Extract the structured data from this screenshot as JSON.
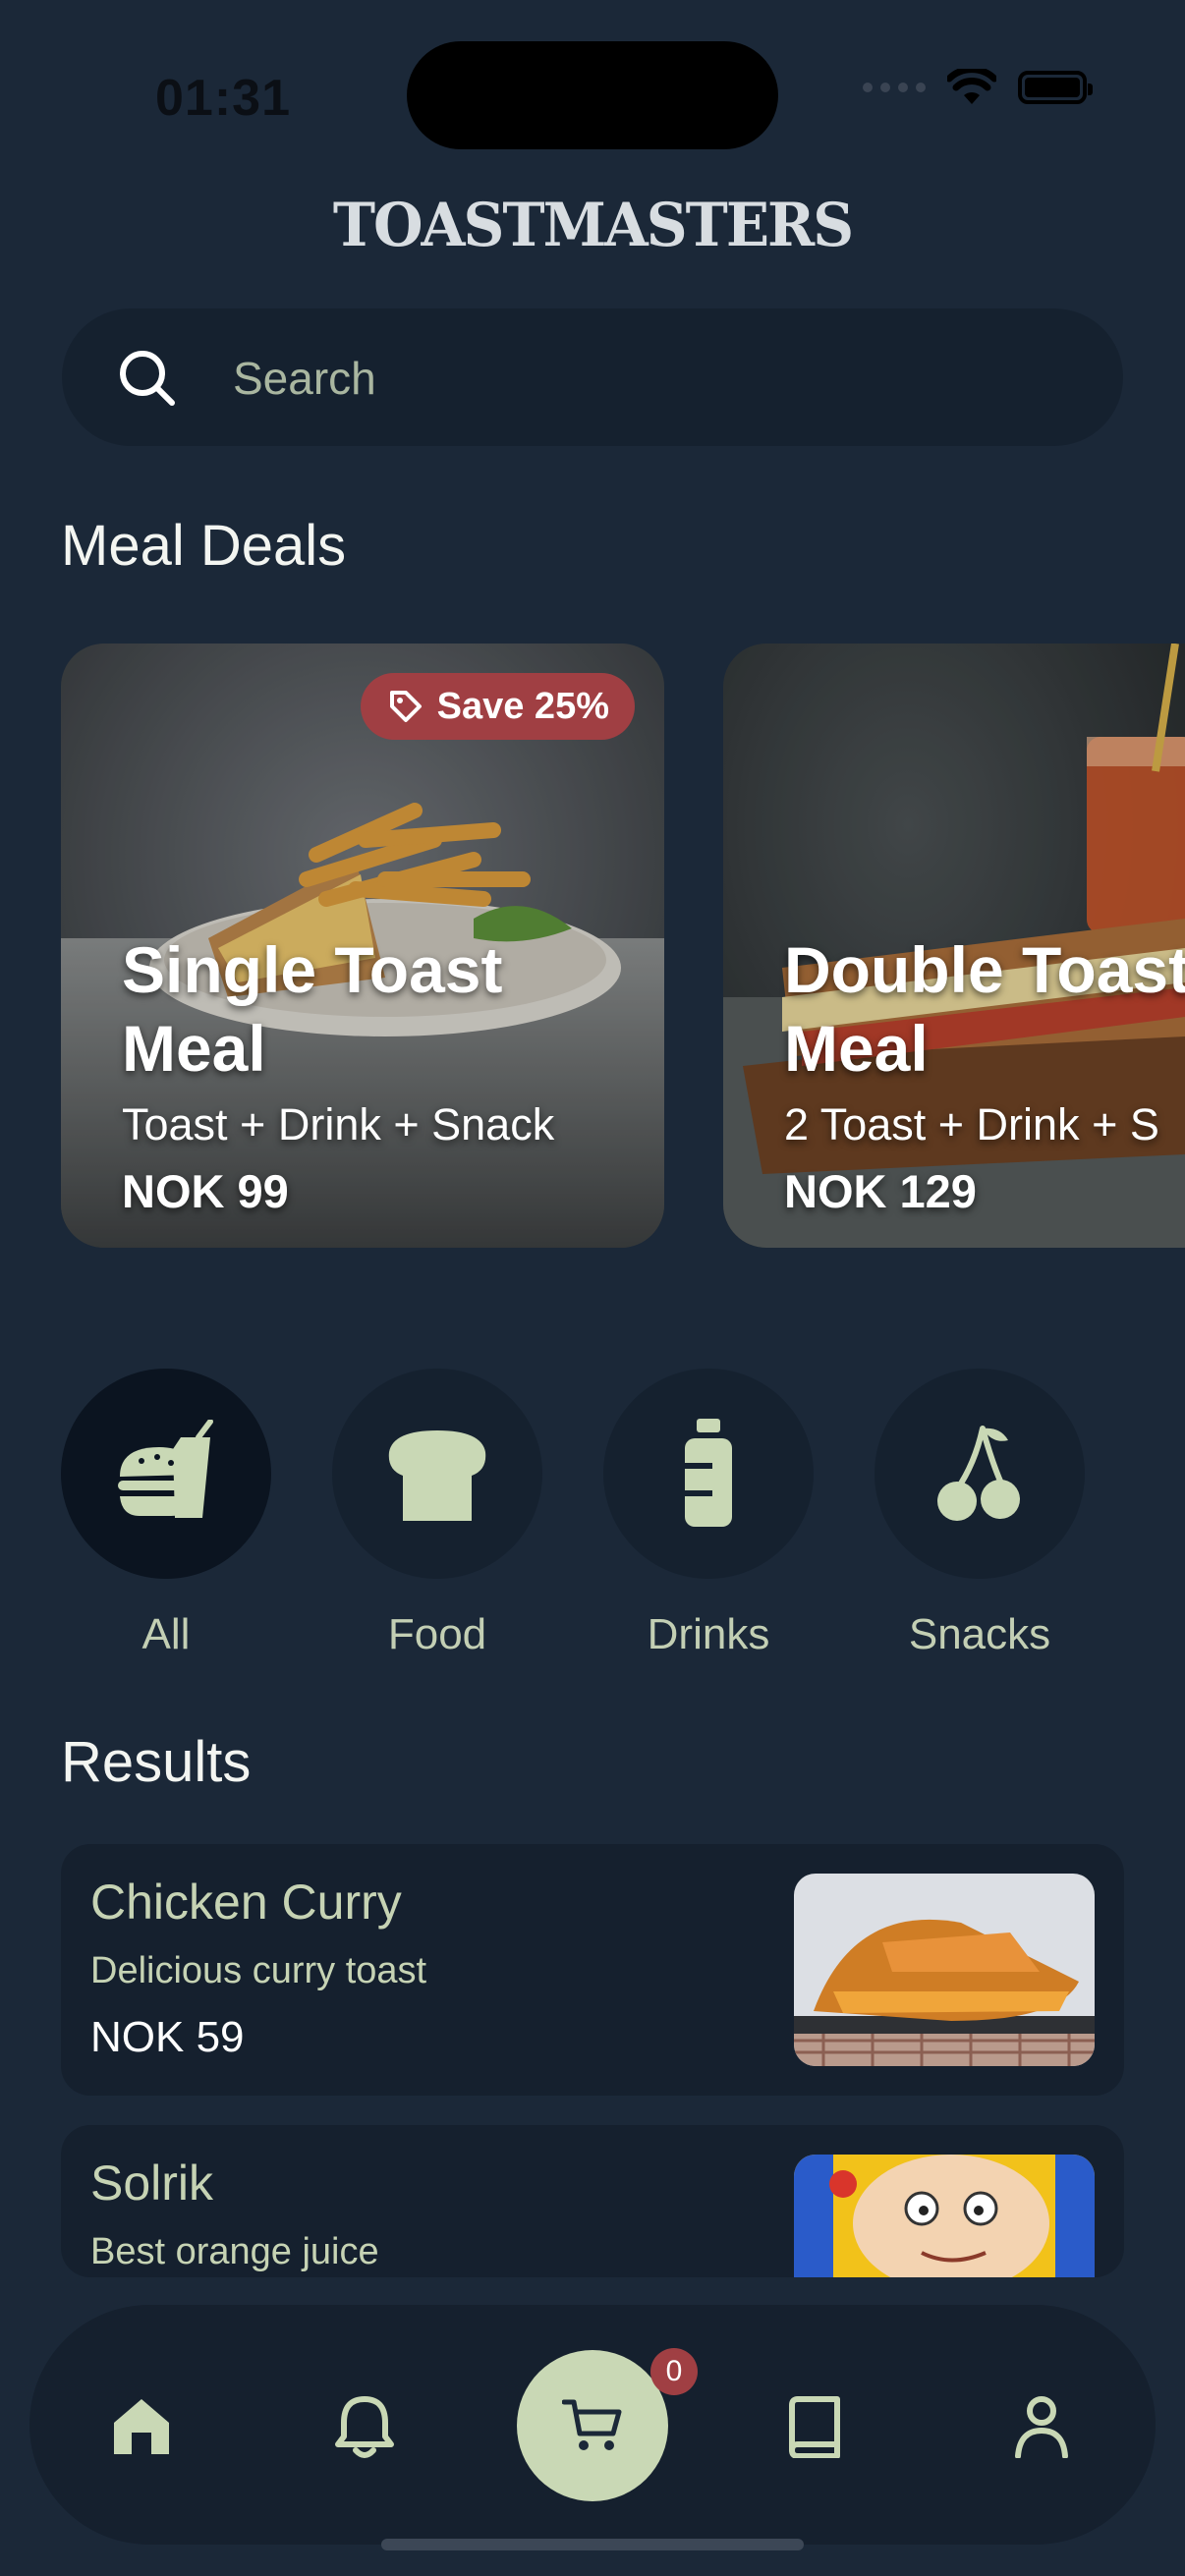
{
  "status_bar": {
    "time": "01:31"
  },
  "brand": "TOASTMASTERS",
  "search": {
    "placeholder": "Search"
  },
  "deals_section": {
    "title": "Meal Deals"
  },
  "deals": [
    {
      "title_line1": "Single Toast",
      "title_line2": "Meal",
      "subtitle": "Toast + Drink + Snack",
      "price": "NOK 99",
      "badge": "Save 25%"
    },
    {
      "title_line1": "Double Toast",
      "title_line2": "Meal",
      "subtitle": "2 Toast + Drink + S",
      "price": "NOK 129"
    }
  ],
  "categories": [
    {
      "label": "All",
      "icon": "fastfood-icon",
      "active": true
    },
    {
      "label": "Food",
      "icon": "bread-icon"
    },
    {
      "label": "Drinks",
      "icon": "bottle-icon"
    },
    {
      "label": "Snacks",
      "icon": "cherries-icon"
    }
  ],
  "results_section": {
    "title": "Results"
  },
  "results": [
    {
      "title": "Chicken Curry",
      "description": "Delicious curry toast",
      "price": "NOK 59"
    },
    {
      "title": "Solrik",
      "description": "Best orange juice"
    }
  ],
  "tabbar": {
    "items": [
      "home-icon",
      "bell-icon",
      "cart-icon",
      "book-icon",
      "person-icon"
    ],
    "cart_count": "0"
  },
  "colors": {
    "background": "#1b2838",
    "accent": "#c9d8b5",
    "badge": "#a03f43"
  }
}
